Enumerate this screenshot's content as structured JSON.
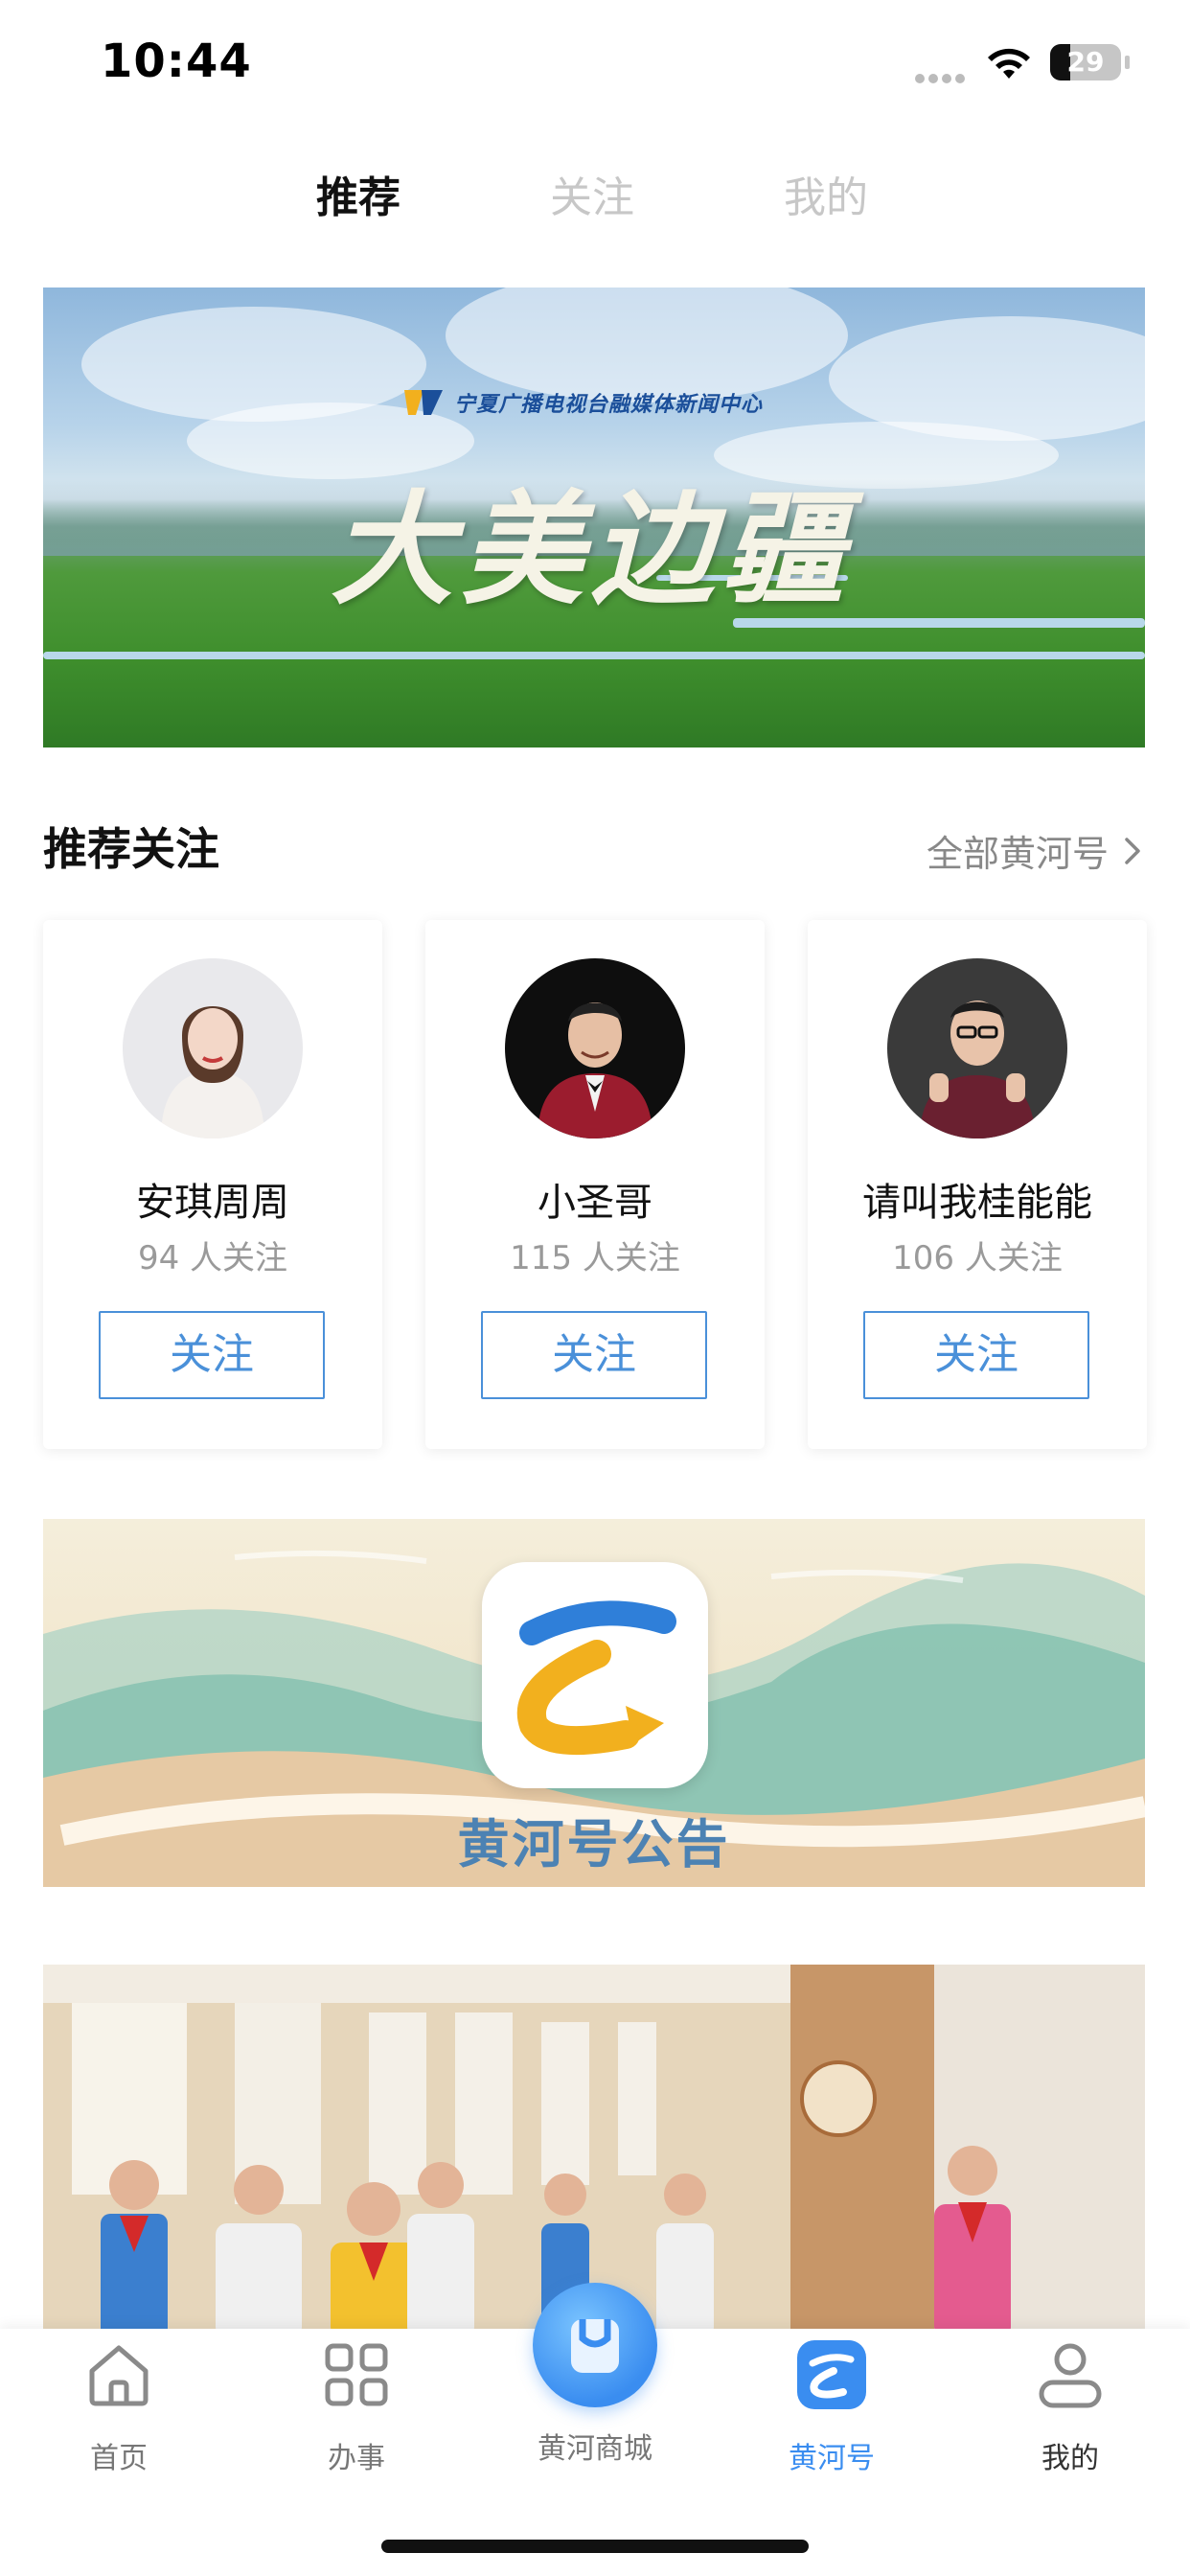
{
  "status_bar": {
    "time": "10:44",
    "battery_level": 29,
    "battery_text": "29"
  },
  "top_tabs": [
    {
      "label": "推荐",
      "active": true
    },
    {
      "label": "关注",
      "active": false
    },
    {
      "label": "我的",
      "active": false
    }
  ],
  "banner": {
    "logo_text": "宁夏广播电视台融媒体新闻中心",
    "title": "大美边疆"
  },
  "recommend": {
    "title": "推荐关注",
    "more_label": "全部黄河号",
    "accounts": [
      {
        "name": "安琪周周",
        "followers": "94 人关注",
        "button": "关注"
      },
      {
        "name": "小圣哥",
        "followers": "115 人关注",
        "button": "关注"
      },
      {
        "name": "请叫我桂能能",
        "followers": "106 人关注",
        "button": "关注"
      }
    ]
  },
  "announcement": {
    "title": "黄河号公告"
  },
  "bottom_nav": {
    "items": [
      {
        "label": "首页",
        "icon": "home-icon",
        "active": false
      },
      {
        "label": "办事",
        "icon": "grid-icon",
        "active": false
      },
      {
        "label": "黄河商城",
        "icon": "mall-icon",
        "active": false
      },
      {
        "label": "黄河号",
        "icon": "huanghe-icon",
        "active": true
      },
      {
        "label": "我的",
        "icon": "user-icon",
        "active": false
      }
    ]
  },
  "colors": {
    "accent": "#3a8df0",
    "follow_border": "#4a90d9",
    "announce_text": "#4c82b3"
  }
}
